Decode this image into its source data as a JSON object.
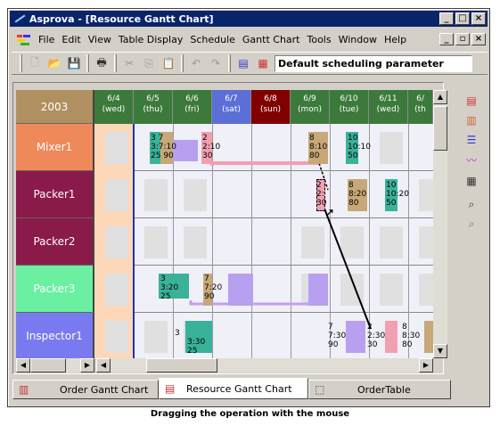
{
  "window": {
    "title": "Asprova - [Resource Gantt Chart]",
    "controls": [
      "_",
      "□",
      "×"
    ]
  },
  "menubar": {
    "items": [
      {
        "label": "File"
      },
      {
        "label": "Edit"
      },
      {
        "label": "View"
      },
      {
        "label": "Table Display"
      },
      {
        "label": "Schedule"
      },
      {
        "label": "Gantt Chart"
      },
      {
        "label": "Tools"
      },
      {
        "label": "Window"
      },
      {
        "label": "Help"
      }
    ],
    "mdi_controls": [
      "_",
      "▫",
      "×"
    ]
  },
  "toolbar": {
    "buttons": [
      "new-icon",
      "open-icon",
      "save-icon",
      "print-icon",
      "cut-icon",
      "copy-icon",
      "paste-icon",
      "undo-icon",
      "redo-icon",
      "schedule-icon",
      "reschedule-icon"
    ],
    "parameter_value": "Default scheduling parameter"
  },
  "gantt": {
    "year": "2003",
    "dates": [
      {
        "date": "6/4",
        "day": "(wed)",
        "color": "#3c7a3c"
      },
      {
        "date": "6/5",
        "day": "(thu)",
        "color": "#3c7a3c"
      },
      {
        "date": "6/6",
        "day": "(fri)",
        "color": "#3c7a3c"
      },
      {
        "date": "6/7",
        "day": "(sat)",
        "color": "#5b6fd6"
      },
      {
        "date": "6/8",
        "day": "(sun)",
        "color": "#800000"
      },
      {
        "date": "6/9",
        "day": "(mon)",
        "color": "#3c7a3c"
      },
      {
        "date": "6/10",
        "day": "(tue)",
        "color": "#3c7a3c"
      },
      {
        "date": "6/11",
        "day": "(wed)",
        "color": "#3c7a3c"
      },
      {
        "date": "6/",
        "day": "(th",
        "color": "#3c7a3c"
      }
    ],
    "resources": [
      {
        "name": "Mixer1",
        "color": "#f0895a"
      },
      {
        "name": "Packer1",
        "color": "#8a1a4a"
      },
      {
        "name": "Packer2",
        "color": "#8a1a4a"
      },
      {
        "name": "Packer3",
        "color": "#6af0a0"
      },
      {
        "name": "Inspector1",
        "color": "#7a7af0"
      }
    ],
    "operation_labels": {
      "mixer_a": [
        "3",
        "7",
        "3:",
        "7:10",
        "25",
        "90"
      ],
      "mixer_b": [
        "2",
        "2:10",
        "30"
      ],
      "mixer_c": [
        "8",
        "8:10",
        "80"
      ],
      "mixer_d": [
        "10",
        "10:10",
        "50"
      ],
      "packer1_a": [
        "2",
        "2:",
        "30"
      ],
      "packer1_b": [
        "8",
        "8:20",
        "80"
      ],
      "packer1_c": [
        "10",
        "10:20",
        "50"
      ],
      "packer3_a": [
        "3",
        "3:20",
        "25"
      ],
      "packer3_b": [
        "7",
        "7:20",
        "90"
      ],
      "inspector_a": [
        "3",
        "3:30",
        "25"
      ],
      "inspector_b": [
        "7",
        "7:30",
        "90"
      ],
      "inspector_c": [
        "2",
        "2:30",
        "30"
      ],
      "inspector_d": [
        "8",
        "8:30",
        "80"
      ]
    }
  },
  "tabs": [
    {
      "label": "Order Gantt Chart",
      "active": false
    },
    {
      "label": "Resource Gantt Chart",
      "active": true
    },
    {
      "label": "OrderTable",
      "active": false
    }
  ],
  "caption": "Dragging the operation with the mouse"
}
